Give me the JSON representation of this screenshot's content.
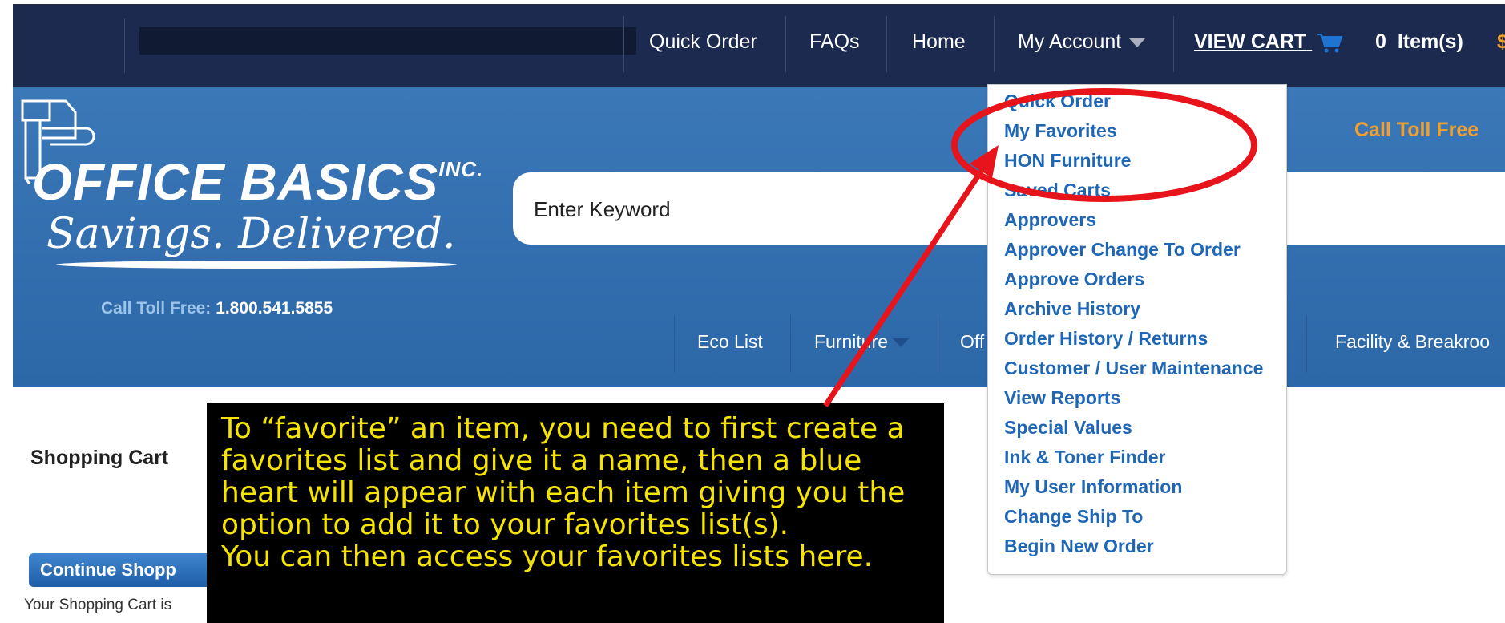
{
  "top_nav": {
    "quick_order": "Quick Order",
    "faqs": "FAQs",
    "home": "Home",
    "my_account": "My Account",
    "view_cart": "VIEW CART",
    "items_count": "0",
    "items_label": "Item(s)"
  },
  "header": {
    "brand_name": "OFFICE BASICS",
    "brand_suffix": "INC.",
    "tagline": "Savings. Delivered.",
    "toll_free_label": "Call Toll Free:",
    "toll_free_number": "1.800.541.5855",
    "toll_free_right": "Call Toll Free",
    "search_placeholder": "Enter Keyword"
  },
  "categories": {
    "eco_list": "Eco List",
    "furniture": "Furniture",
    "office_partial": "Off",
    "facility": "Facility & Breakroo"
  },
  "account_menu": [
    "Quick Order",
    "My Favorites",
    "HON Furniture",
    "Saved Carts",
    "Approvers",
    "Approver Change To Order",
    "Approve Orders",
    "Archive History",
    "Order History / Returns",
    "Customer / User Maintenance",
    "View Reports",
    "Special Values",
    "Ink & Toner Finder",
    "My User Information",
    "Change Ship To",
    "Begin New Order"
  ],
  "main": {
    "page_title": "Shopping Cart",
    "continue_button": "Continue Shopp",
    "cart_status": "Your Shopping Cart is"
  },
  "callout": {
    "line1": "To “favorite” an item, you need to first create a",
    "line2": "favorites list and give it a name, then a blue",
    "line3": "heart will appear with each item giving you the",
    "line4": "option to add it to your favorites list(s).",
    "line5": "You can then access your favorites lists here."
  },
  "colors": {
    "top_nav_bg": "#1b2a4e",
    "header_bg": "#2f6cab",
    "menu_link": "#1f66b5",
    "annotation_red": "#e8141b",
    "callout_text": "#f5e400",
    "toll_free_orange": "#f0a030"
  },
  "icons": {
    "cart": "shopping-cart-icon",
    "caret": "caret-down-icon",
    "logo": "office-supplies-logo-icon"
  }
}
